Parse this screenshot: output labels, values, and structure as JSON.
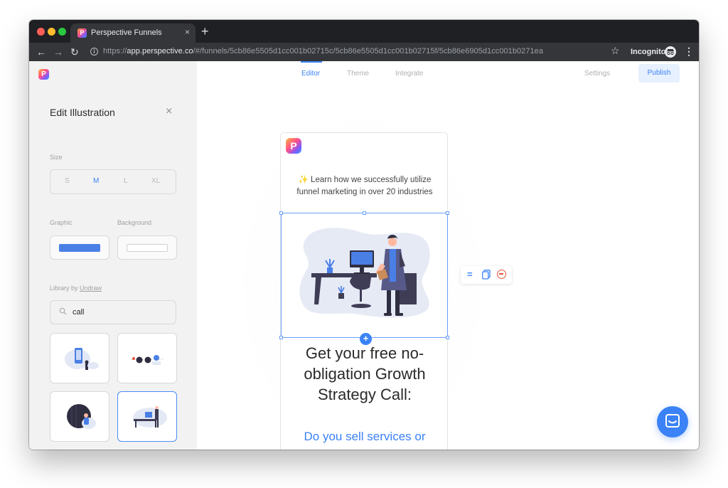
{
  "browser": {
    "tab_title": "Perspective Funnels",
    "tab_close": "×",
    "new_tab": "+",
    "url_scheme": "https://",
    "url_host": "app.perspective.co",
    "url_path": "/#/funnels/5cb86e5505d1cc001b02715c/5cb86e5505d1cc001b02715f/5cb86e6905d1cc001b0271ea",
    "incognito_label": "Incognito"
  },
  "topnav": {
    "editor": "Editor",
    "theme": "Theme",
    "integrate": "Integrate",
    "settings": "Settings",
    "publish": "Publish"
  },
  "sidebar": {
    "title": "Edit Illustration",
    "close": "×",
    "size_label": "Size",
    "sizes": [
      "S",
      "M",
      "L",
      "XL"
    ],
    "selected_size": "M",
    "graphic_label": "Graphic",
    "background_label": "Background",
    "graphic_color": "#4a7fe6",
    "background_color": "#ffffff",
    "library_prefix": "Library by ",
    "library_link": "Undraw",
    "search_value": "call"
  },
  "canvas": {
    "intro_text": "✨ Learn how we successfully utilize funnel marketing in over 20 industries",
    "heading": "Get your free no-obligation Growth Strategy Call:",
    "subheading": "Do you sell services or",
    "add_label": "+",
    "tool_align": "="
  },
  "colors": {
    "accent": "#3b82f6",
    "danger": "#e5533c",
    "sidebar_bg": "#f2f2f2"
  }
}
